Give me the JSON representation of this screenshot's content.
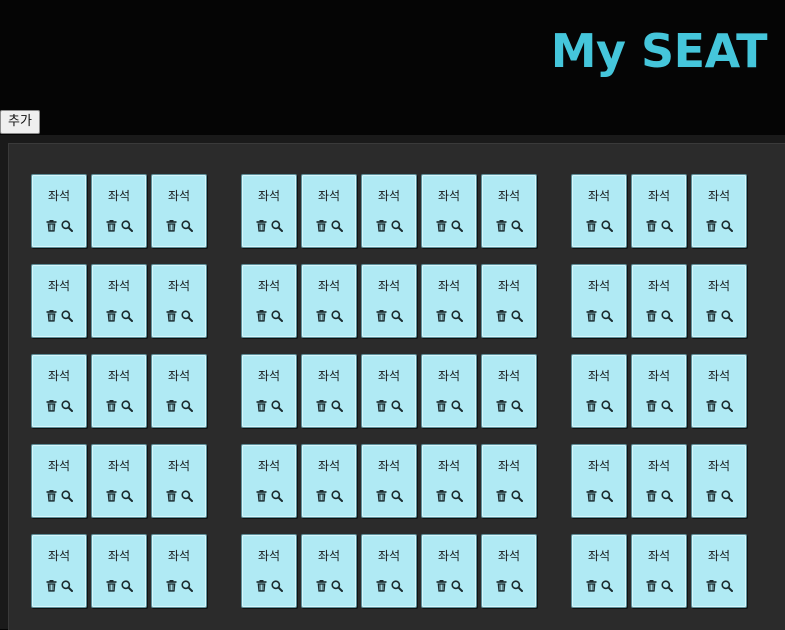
{
  "header": {
    "title": "My SEAT",
    "add_button_label": "추가"
  },
  "seat_label": "좌석",
  "seat_actions": {
    "delete_icon": "trash-icon",
    "view_icon": "search-icon"
  },
  "colors": {
    "title": "#45c6db",
    "seat_fill": "#b0eaf4",
    "seat_border": "#5d8f99",
    "stage": "#2b2b2b",
    "background": "#050505"
  },
  "layout": {
    "rows": 5,
    "groups": [
      {
        "name": "left",
        "seats_per_row": 3
      },
      {
        "name": "center",
        "seats_per_row": 5
      },
      {
        "name": "right",
        "seats_per_row": 3
      }
    ]
  }
}
